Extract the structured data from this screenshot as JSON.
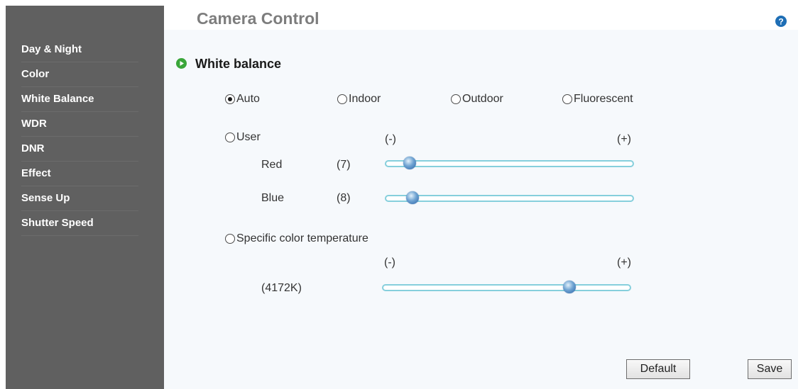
{
  "header": {
    "title": "Camera Control"
  },
  "sidebar": {
    "items": [
      {
        "label": "Day & Night"
      },
      {
        "label": "Color"
      },
      {
        "label": "White Balance"
      },
      {
        "label": "WDR"
      },
      {
        "label": "DNR"
      },
      {
        "label": "Effect"
      },
      {
        "label": "Sense Up"
      },
      {
        "label": "Shutter Speed"
      }
    ]
  },
  "section": {
    "title": "White balance"
  },
  "modes": {
    "auto": "Auto",
    "indoor": "Indoor",
    "outdoor": "Outdoor",
    "fluorescent": "Fluorescent",
    "user": "User",
    "specific": "Specific color temperature",
    "selected": "Auto"
  },
  "user": {
    "minus": "(-)",
    "plus": "(+)",
    "red": {
      "label": "Red",
      "value": "(7)",
      "level": 0.07
    },
    "blue": {
      "label": "Blue",
      "value": "(8)",
      "level": 0.08
    }
  },
  "temperature": {
    "minus": "(-)",
    "plus": "(+)",
    "value": "(4172K)",
    "level": 0.73
  },
  "buttons": {
    "default": "Default",
    "save": "Save"
  },
  "icons": {
    "help": "help-icon",
    "section": "play-circle-icon"
  },
  "colors": {
    "sidebar_bg": "#606060",
    "panel_bg": "#f6f9fc",
    "slider_track": "#86cfdc",
    "accent_green": "#3aa63a",
    "help_blue": "#1e6eb5"
  }
}
